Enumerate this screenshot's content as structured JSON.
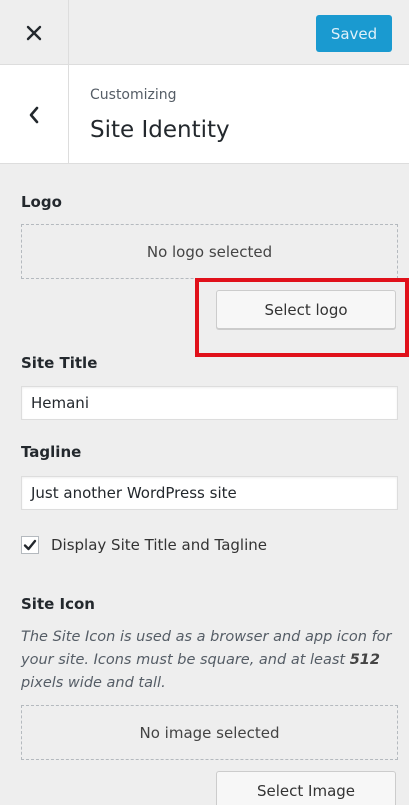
{
  "topbar": {
    "close_icon": "close-icon",
    "saved_label": "Saved",
    "saved_color": "#1a9ad0"
  },
  "header": {
    "back_icon": "chevron-left-icon",
    "breadcrumb": "Customizing",
    "title": "Site Identity"
  },
  "logo": {
    "label": "Logo",
    "placeholder": "No logo selected",
    "button_label": "Select logo",
    "highlight_color": "#e0101a"
  },
  "site_title": {
    "label": "Site Title",
    "value": "Hemani"
  },
  "tagline": {
    "label": "Tagline",
    "value": "Just another WordPress site"
  },
  "display_toggle": {
    "label": "Display Site Title and Tagline",
    "checked": true
  },
  "site_icon": {
    "label": "Site Icon",
    "description_before": "The Site Icon is used as a browser and app icon for your site. Icons must be square, and at least ",
    "description_bold": "512",
    "description_after": " pixels wide and tall.",
    "placeholder": "No image selected",
    "button_label": "Select Image"
  }
}
